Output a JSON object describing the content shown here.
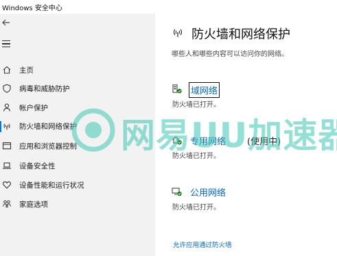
{
  "window": {
    "title": "Windows 安全中心"
  },
  "sidebar": {
    "items": [
      {
        "label": "主页",
        "icon": "home-icon"
      },
      {
        "label": "病毒和威胁防护",
        "icon": "shield-icon"
      },
      {
        "label": "帐户保护",
        "icon": "person-icon"
      },
      {
        "label": "防火墙和网络保护",
        "icon": "wireless-icon",
        "active": true
      },
      {
        "label": "应用和浏览器控制",
        "icon": "app-window-icon"
      },
      {
        "label": "设备安全性",
        "icon": "laptop-icon"
      },
      {
        "label": "设备性能和运行状况",
        "icon": "heart-icon"
      },
      {
        "label": "家庭选项",
        "icon": "family-icon"
      }
    ]
  },
  "main": {
    "title": "防火墙和网络保护",
    "description": "哪些人和哪些内容可以访问你的网络。",
    "networks": [
      {
        "label": "域网络",
        "suffix": "",
        "status": "防火墙已打开。",
        "icon": "domain-network-icon"
      },
      {
        "label": "专用网络",
        "suffix": "(使用中)",
        "status": "防火墙已打开。",
        "icon": "private-network-icon"
      },
      {
        "label": "公用网络",
        "suffix": "",
        "status": "防火墙已打开。",
        "icon": "public-network-icon"
      }
    ],
    "allow_link": "允许应用通过防火墙"
  },
  "watermark": {
    "text": "网易UU加速器"
  },
  "colors": {
    "accent": "#0078d4",
    "link": "#0067b8",
    "status_ok": "#107c10",
    "watermark": "#3fc7b5"
  }
}
